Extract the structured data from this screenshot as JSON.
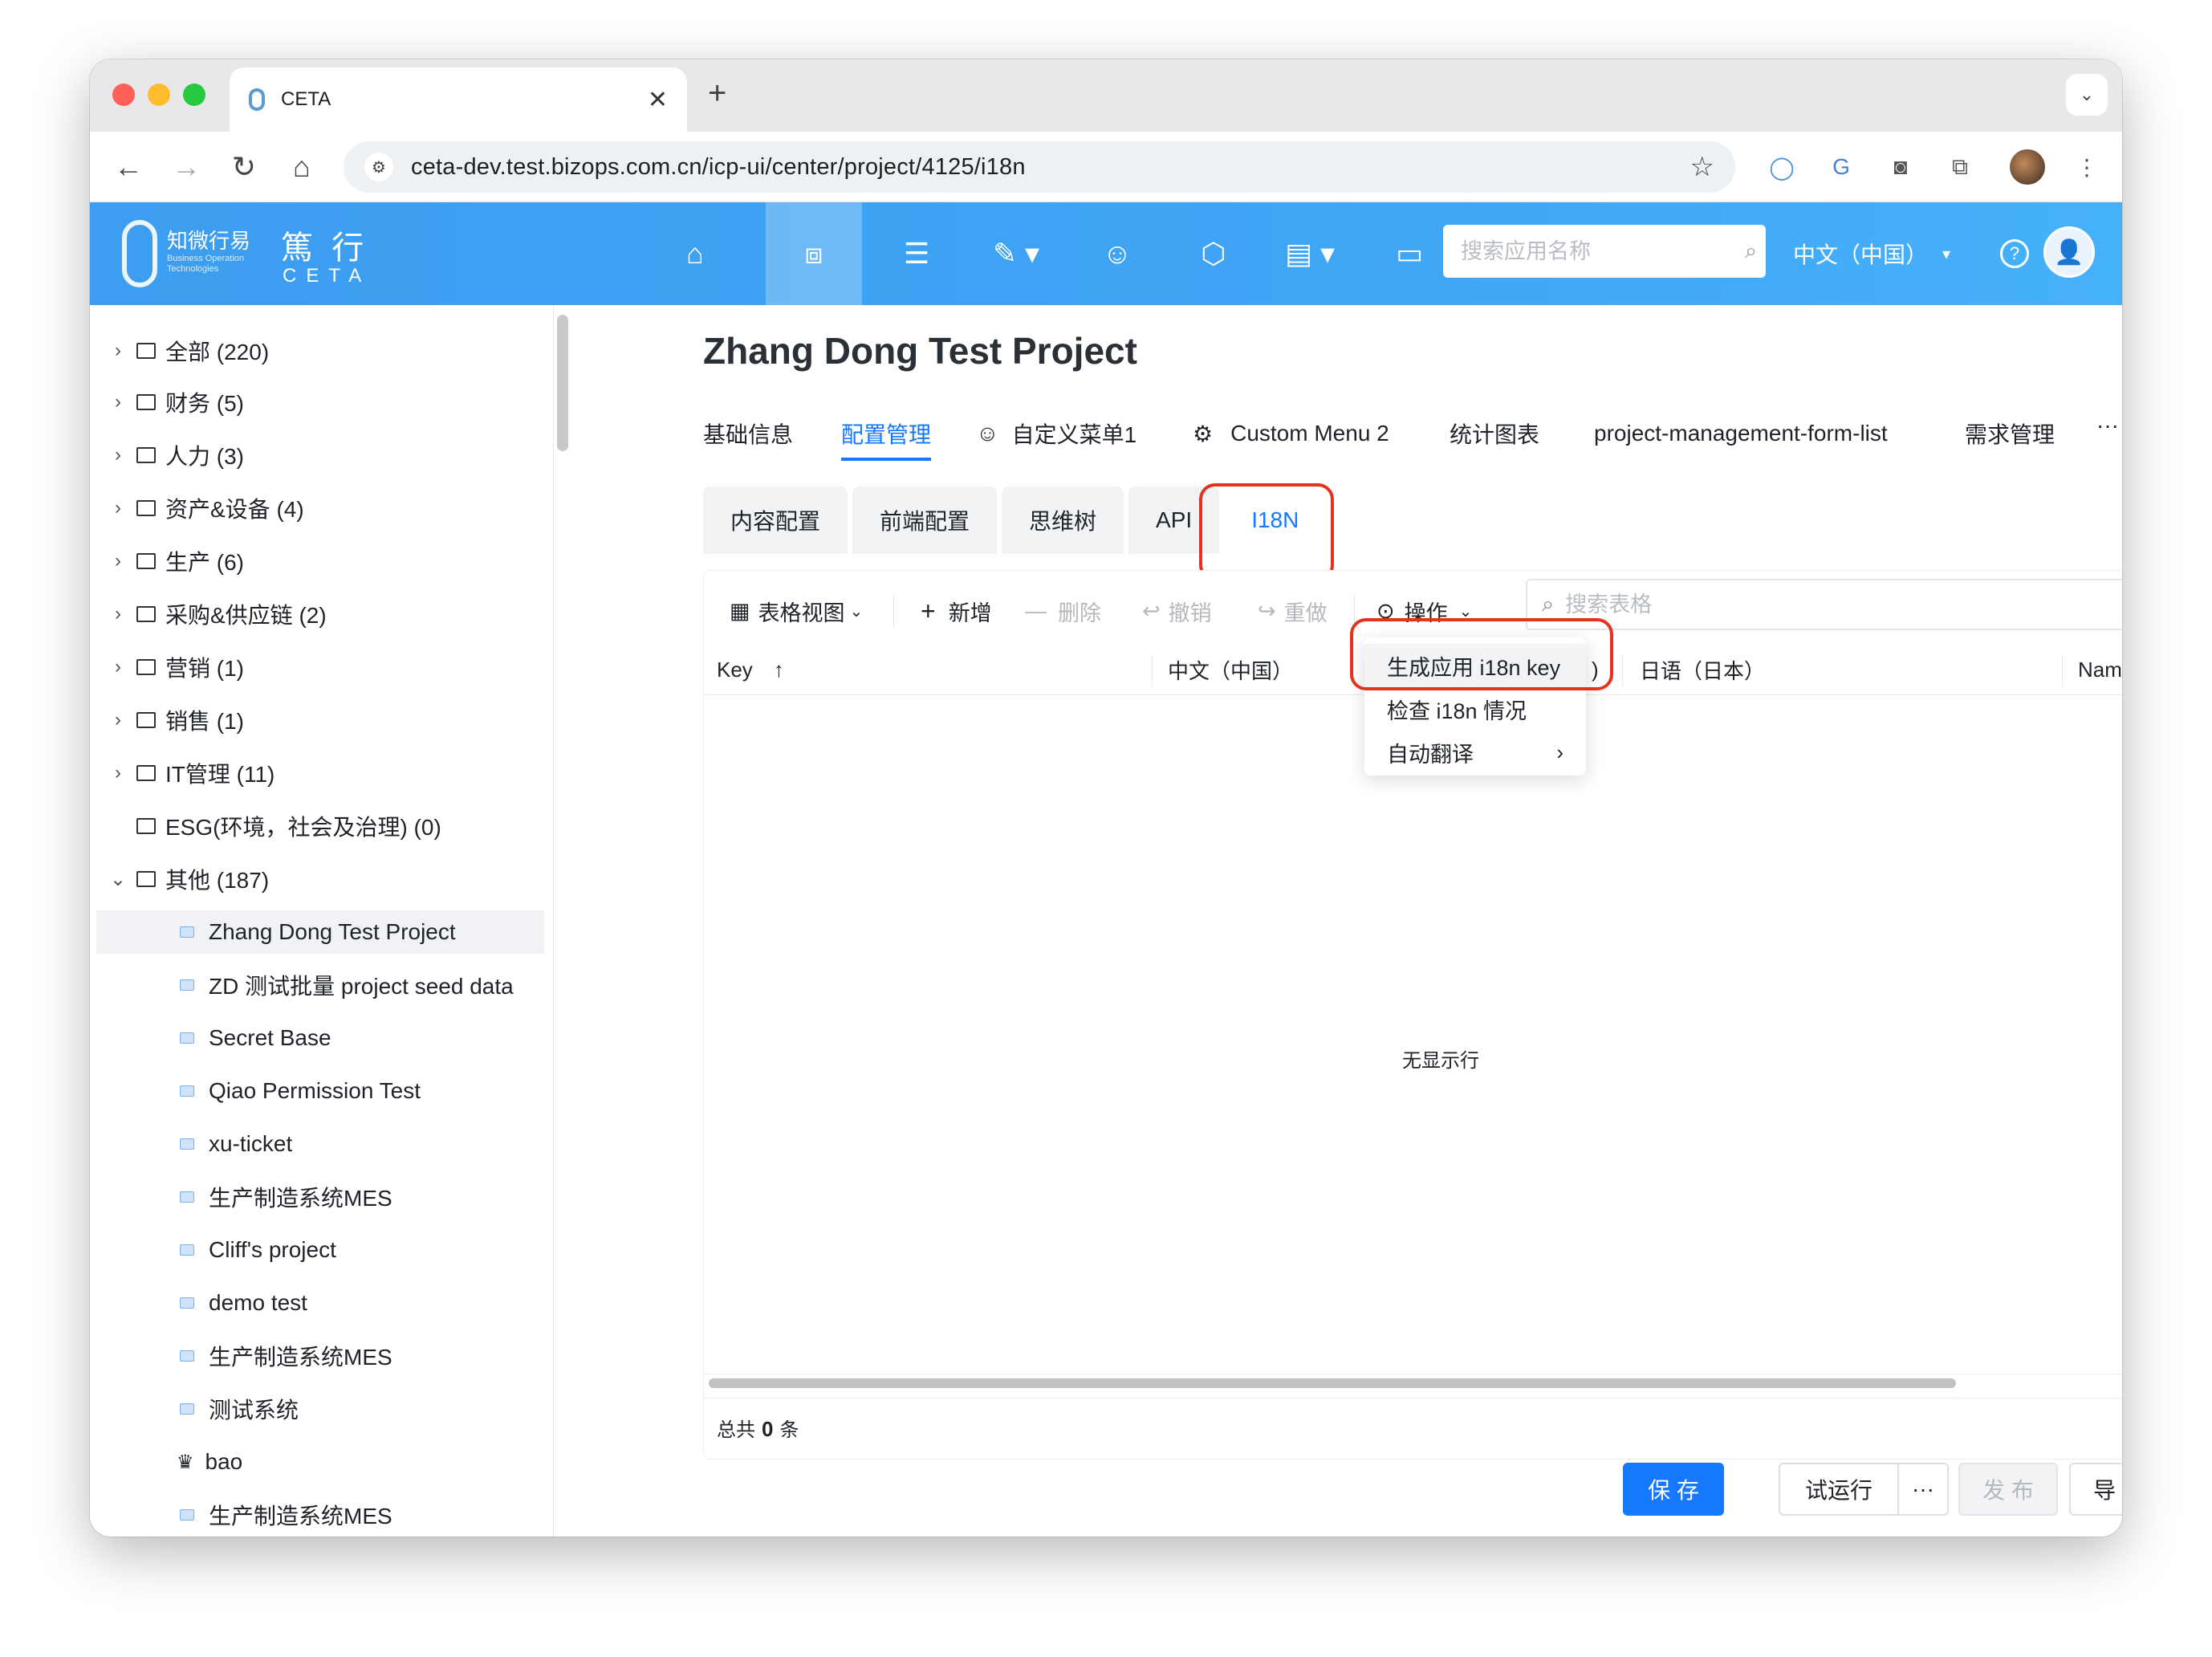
{
  "browser": {
    "tab_title": "CETA",
    "url": "ceta-dev.test.bizops.com.cn/icp-ui/center/project/4125/i18n"
  },
  "app": {
    "logo_cn": "知微行易",
    "logo_en": "Business Operation Technologies",
    "brand_cn": "篤 行",
    "brand_en": "CETA",
    "search_placeholder": "搜索应用名称",
    "language": "中文（中国）",
    "brand_color": "#3fa5f5"
  },
  "sidebar": {
    "items": [
      {
        "label": "全部 (220)"
      },
      {
        "label": "财务 (5)"
      },
      {
        "label": "人力 (3)"
      },
      {
        "label": "资产&设备 (4)"
      },
      {
        "label": "生产 (6)"
      },
      {
        "label": "采购&供应链 (2)"
      },
      {
        "label": "营销 (1)"
      },
      {
        "label": "销售 (1)"
      },
      {
        "label": "IT管理 (11)"
      },
      {
        "label": "ESG(环境，社会及治理) (0)"
      },
      {
        "label": "其他 (187)"
      }
    ],
    "children": [
      {
        "label": "Zhang Dong Test Project"
      },
      {
        "label": "ZD 测试批量 project seed data"
      },
      {
        "label": "Secret Base"
      },
      {
        "label": "Qiao Permission Test"
      },
      {
        "label": "xu-ticket"
      },
      {
        "label": "生产制造系统MES"
      },
      {
        "label": "Cliff's project"
      },
      {
        "label": "demo test"
      },
      {
        "label": "生产制造系统MES"
      },
      {
        "label": "测试系统"
      },
      {
        "label": "bao"
      },
      {
        "label": "生产制造系统MES"
      }
    ]
  },
  "main": {
    "title": "Zhang Dong Test Project",
    "tabs": [
      {
        "label": "基础信息"
      },
      {
        "label": "配置管理"
      },
      {
        "label": "自定义菜单1"
      },
      {
        "label": "Custom Menu 2"
      },
      {
        "label": "统计图表"
      },
      {
        "label": "project-management-form-list"
      },
      {
        "label": "需求管理"
      }
    ],
    "more": "···",
    "sub_tabs": [
      {
        "label": "内容配置"
      },
      {
        "label": "前端配置"
      },
      {
        "label": "思维树"
      },
      {
        "label": "API"
      },
      {
        "label": "I18N"
      }
    ],
    "toolbar": {
      "view": "表格视图",
      "add": "新增",
      "delete": "删除",
      "undo": "撤销",
      "redo": "重做",
      "actions": "操作",
      "search_placeholder": "搜索表格"
    },
    "columns": [
      {
        "label": "Key"
      },
      {
        "label": "中文（中国）"
      },
      {
        "label": ")"
      },
      {
        "label": "日语（日本）"
      },
      {
        "label": "Name"
      }
    ],
    "empty_text": "无显示行",
    "total_prefix": "总共",
    "total_count": "0",
    "total_suffix": "条",
    "dropdown": [
      {
        "label": "生成应用 i18n key"
      },
      {
        "label": "检查 i18n 情况"
      },
      {
        "label": "自动翻译"
      }
    ],
    "buttons": {
      "save": "保 存",
      "trial": "试运行",
      "more": "···",
      "publish": "发 布",
      "export": "导 出"
    },
    "highlight_color": "#e5321f",
    "accent_color": "#1677ff"
  }
}
